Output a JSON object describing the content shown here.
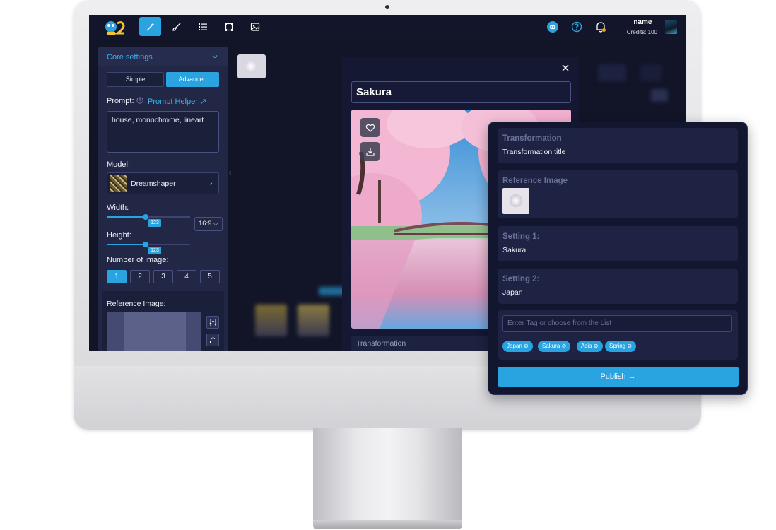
{
  "topbar": {
    "username": "name_",
    "credits": "Credits: 100",
    "nav": [
      "magic-wand",
      "brush",
      "list",
      "crop",
      "image"
    ]
  },
  "sidebar": {
    "core_settings": "Core settings",
    "mode_simple": "Simple",
    "mode_advanced": "Advanced",
    "prompt_label": "Prompt:",
    "prompt_helper": "Prompt Helper ↗",
    "prompt_value": "house, monochrome, lineart",
    "model_label": "Model:",
    "model_name": "Dreamshaper",
    "width_label": "Width:",
    "width_value": "123",
    "width_level": 0.47,
    "height_label": "Height:",
    "height_value": "123",
    "height_level": 0.47,
    "aspect_ratio": "16:9",
    "num_images_label": "Number of image:",
    "num_images": [
      "1",
      "2",
      "3",
      "4",
      "5"
    ],
    "num_selected": "1",
    "reference_image_label": "Reference Image:"
  },
  "modal": {
    "title": "Sakura",
    "transformation_label": "Transformation"
  },
  "card": {
    "transformation_label": "Transformation",
    "transformation_value": "Transformation title",
    "reference_image_label": "Reference Image",
    "setting1_label": "Setting 1:",
    "setting1_value": "Sakura",
    "setting2_label": "Setting 2:",
    "setting2_value": "Japan",
    "tag_placeholder": "Enter Tag or choose from the List",
    "tags": [
      "Japan",
      "Sakura",
      "Asia",
      "Spring"
    ],
    "publish_label": "Publish →"
  },
  "colors": {
    "accent": "#2aa4e0",
    "panel": "#222745",
    "screen_bg": "#121528"
  }
}
